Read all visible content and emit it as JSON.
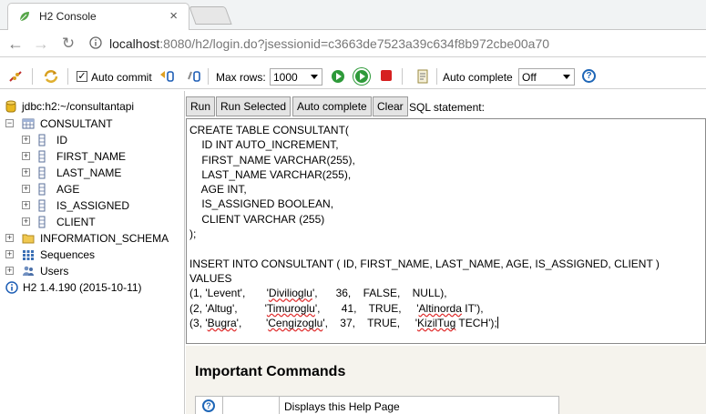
{
  "browser": {
    "tab_title": "H2 Console",
    "tab_close": "×",
    "url_host": "localhost",
    "url_rest": ":8080/h2/login.do?jsessionid=c3663de7523a39c634f8b972cbe00a70"
  },
  "toolbar": {
    "auto_commit_label": "Auto commit",
    "auto_commit_checked": true,
    "max_rows_label": "Max rows:",
    "max_rows_value": "1000",
    "auto_complete_label": "Auto complete",
    "auto_complete_value": "Off"
  },
  "tree": {
    "connection": "jdbc:h2:~/consultantapi",
    "table": "CONSULTANT",
    "columns": [
      "ID",
      "FIRST_NAME",
      "LAST_NAME",
      "AGE",
      "IS_ASSIGNED",
      "CLIENT"
    ],
    "schema": "INFORMATION_SCHEMA",
    "sequences": "Sequences",
    "users": "Users",
    "version": "H2 1.4.190 (2015-10-11)"
  },
  "editor": {
    "run": "Run",
    "run_selected": "Run Selected",
    "auto_complete": "Auto complete",
    "clear": "Clear",
    "sql_label": "SQL statement:"
  },
  "sql_lines": [
    "CREATE TABLE CONSULTANT(",
    "    ID INT AUTO_INCREMENT,",
    "    FIRST_NAME VARCHAR(255),",
    "    LAST_NAME VARCHAR(255),",
    "    AGE INT,",
    "    IS_ASSIGNED BOOLEAN,",
    "    CLIENT VARCHAR (255)",
    ");",
    "",
    "INSERT INTO CONSULTANT ( ID, FIRST_NAME, LAST_NAME, AGE, IS_ASSIGNED, CLIENT )",
    "VALUES",
    "(1, 'Levent',       'Divilioglu',      36,    FALSE,    NULL),",
    "(2, 'Altug',         'Timuroglu',       41,    TRUE,     'Altinorda IT'),",
    "(3, 'Bugra',        'Cengizoglu',    37,    TRUE,     'KizilTug TECH');"
  ],
  "result": {
    "heading": "Important Commands",
    "row1_desc": "Displays this Help Page"
  }
}
